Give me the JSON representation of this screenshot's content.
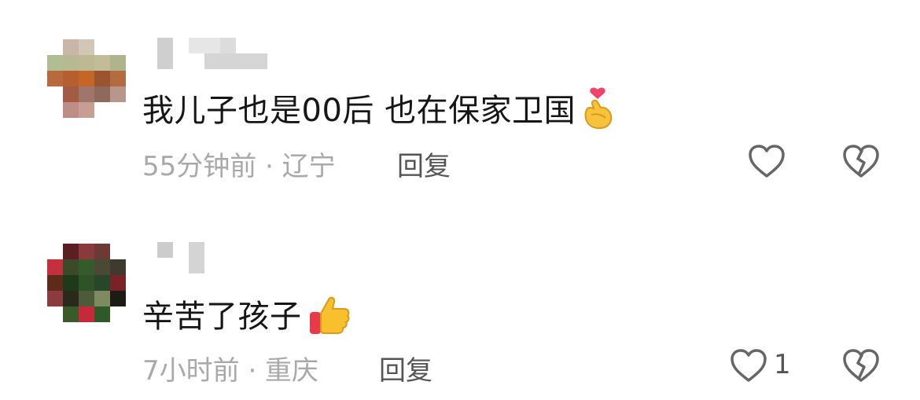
{
  "comments": [
    {
      "text": "我儿子也是00后 也在保家卫国",
      "emoji": "finger-heart",
      "meta": "55分钟前 · 辽宁",
      "reply_label": "回复",
      "like_count": ""
    },
    {
      "text": "辛苦了孩子",
      "emoji": "thumbs-up",
      "meta": "7小时前 · 重庆",
      "reply_label": "回复",
      "like_count": "1"
    }
  ],
  "colors": {
    "text": "#161616",
    "meta": "#a9a9a9",
    "reply": "#555555",
    "icon": "#666666"
  },
  "icons": [
    "like-heart-icon",
    "dislike-broken-heart-icon"
  ]
}
